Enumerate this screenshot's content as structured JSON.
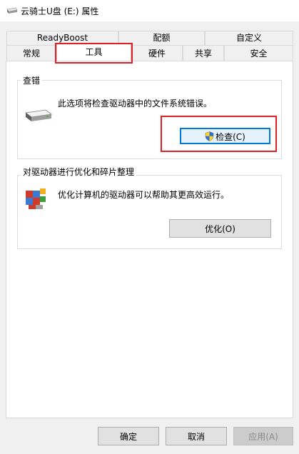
{
  "window": {
    "title": "云骑士U盘 (E:) 属性"
  },
  "tabs": {
    "row1": [
      "ReadyBoost",
      "配额",
      "自定义"
    ],
    "row2": [
      "常规",
      "工具",
      "硬件",
      "共享",
      "安全"
    ],
    "active": "工具"
  },
  "check_section": {
    "label": "查错",
    "description": "此选项将检查驱动器中的文件系统错误。",
    "button_label": "检查(C)"
  },
  "optimize_section": {
    "label": "对驱动器进行优化和碎片整理",
    "description": "优化计算机的驱动器可以帮助其更高效运行。",
    "button_label": "优化(O)"
  },
  "footer": {
    "ok_label": "确定",
    "cancel_label": "取消",
    "apply_label": "应用(A)"
  },
  "colors": {
    "highlight": "#e02028",
    "accent": "#0078d7"
  }
}
